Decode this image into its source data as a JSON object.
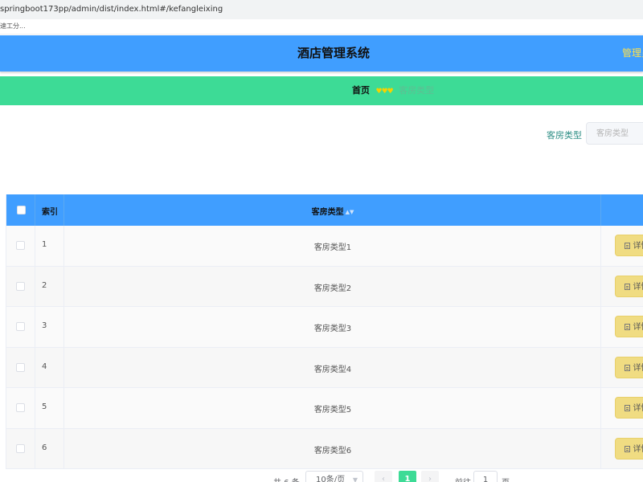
{
  "browser": {
    "url": "springboot173pp/admin/dist/index.html#/kefangleixing",
    "bookmark": "速工分..."
  },
  "header": {
    "title": "酒店管理系统",
    "admin_link": "管理员"
  },
  "breadcrumb": {
    "home": "首页",
    "separator": "♥♥♥",
    "current": "客房类型"
  },
  "search": {
    "label": "客房类型",
    "placeholder": "客房类型"
  },
  "table": {
    "columns": {
      "index": "索引",
      "type": "客房类型"
    },
    "detail_label": "详情",
    "rows": [
      {
        "index": "1",
        "type": "客房类型1"
      },
      {
        "index": "2",
        "type": "客房类型2"
      },
      {
        "index": "3",
        "type": "客房类型3"
      },
      {
        "index": "4",
        "type": "客房类型4"
      },
      {
        "index": "5",
        "type": "客房类型5"
      },
      {
        "index": "6",
        "type": "客房类型6"
      }
    ]
  },
  "pagination": {
    "total": "共 6 条",
    "page_size": "10条/页",
    "prev": "‹",
    "current_page": "1",
    "next": "›",
    "goto_label": "前往",
    "goto_value": "1",
    "goto_unit": "页"
  },
  "colors": {
    "header": "#409eff",
    "navbar": "#3ddb96",
    "detail_button": "#f0dc82",
    "admin_link": "#ffe14a"
  }
}
